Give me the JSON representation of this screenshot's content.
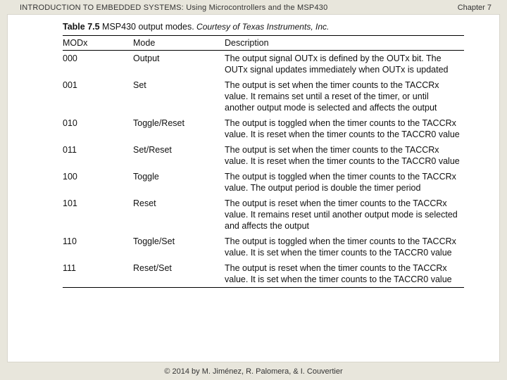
{
  "header": {
    "book_title": "INTRODUCTION TO EMBEDDED SYSTEMS:",
    "book_subtitle": " Using Microcontrollers and the MSP430",
    "chapter": "Chapter 7"
  },
  "table": {
    "number": "Table 7.5",
    "title": " MSP430 output modes.",
    "courtesy": " Courtesy of Texas Instruments, Inc.",
    "columns": [
      "MODx",
      "Mode",
      "Description"
    ],
    "rows": [
      {
        "modx": "000",
        "mode": "Output",
        "desc": "The output signal OUTx is defined by the OUTx bit. The OUTx signal updates immediately when OUTx is updated"
      },
      {
        "modx": "001",
        "mode": "Set",
        "desc": "The output is set when the timer counts to the TACCRx value. It remains set until a reset of the timer, or until another output mode is selected and affects the output"
      },
      {
        "modx": "010",
        "mode": "Toggle/Reset",
        "desc": "The output is toggled when the timer counts to the TACCRx value. It is reset when the timer counts to the TACCR0 value"
      },
      {
        "modx": "011",
        "mode": "Set/Reset",
        "desc": "The output is set when the timer counts to the TACCRx value. It is reset when the timer counts to the TACCR0 value"
      },
      {
        "modx": "100",
        "mode": "Toggle",
        "desc": "The output is toggled when the timer counts to the TACCRx value. The output period is double the timer period"
      },
      {
        "modx": "101",
        "mode": "Reset",
        "desc": "The output is reset when the timer counts to the TACCRx value. It remains reset until another output mode is selected and affects the output"
      },
      {
        "modx": "110",
        "mode": "Toggle/Set",
        "desc": "The output is toggled when the timer counts to the TACCRx value. It is set when the timer counts to the TACCR0 value"
      },
      {
        "modx": "111",
        "mode": "Reset/Set",
        "desc": "The output is reset when the timer counts to the TACCRx value. It is set when the timer counts to the TACCR0 value"
      }
    ]
  },
  "footer": {
    "copyright": "© 2014 by M. Jiménez, R. Palomera, & I. Couvertier"
  }
}
